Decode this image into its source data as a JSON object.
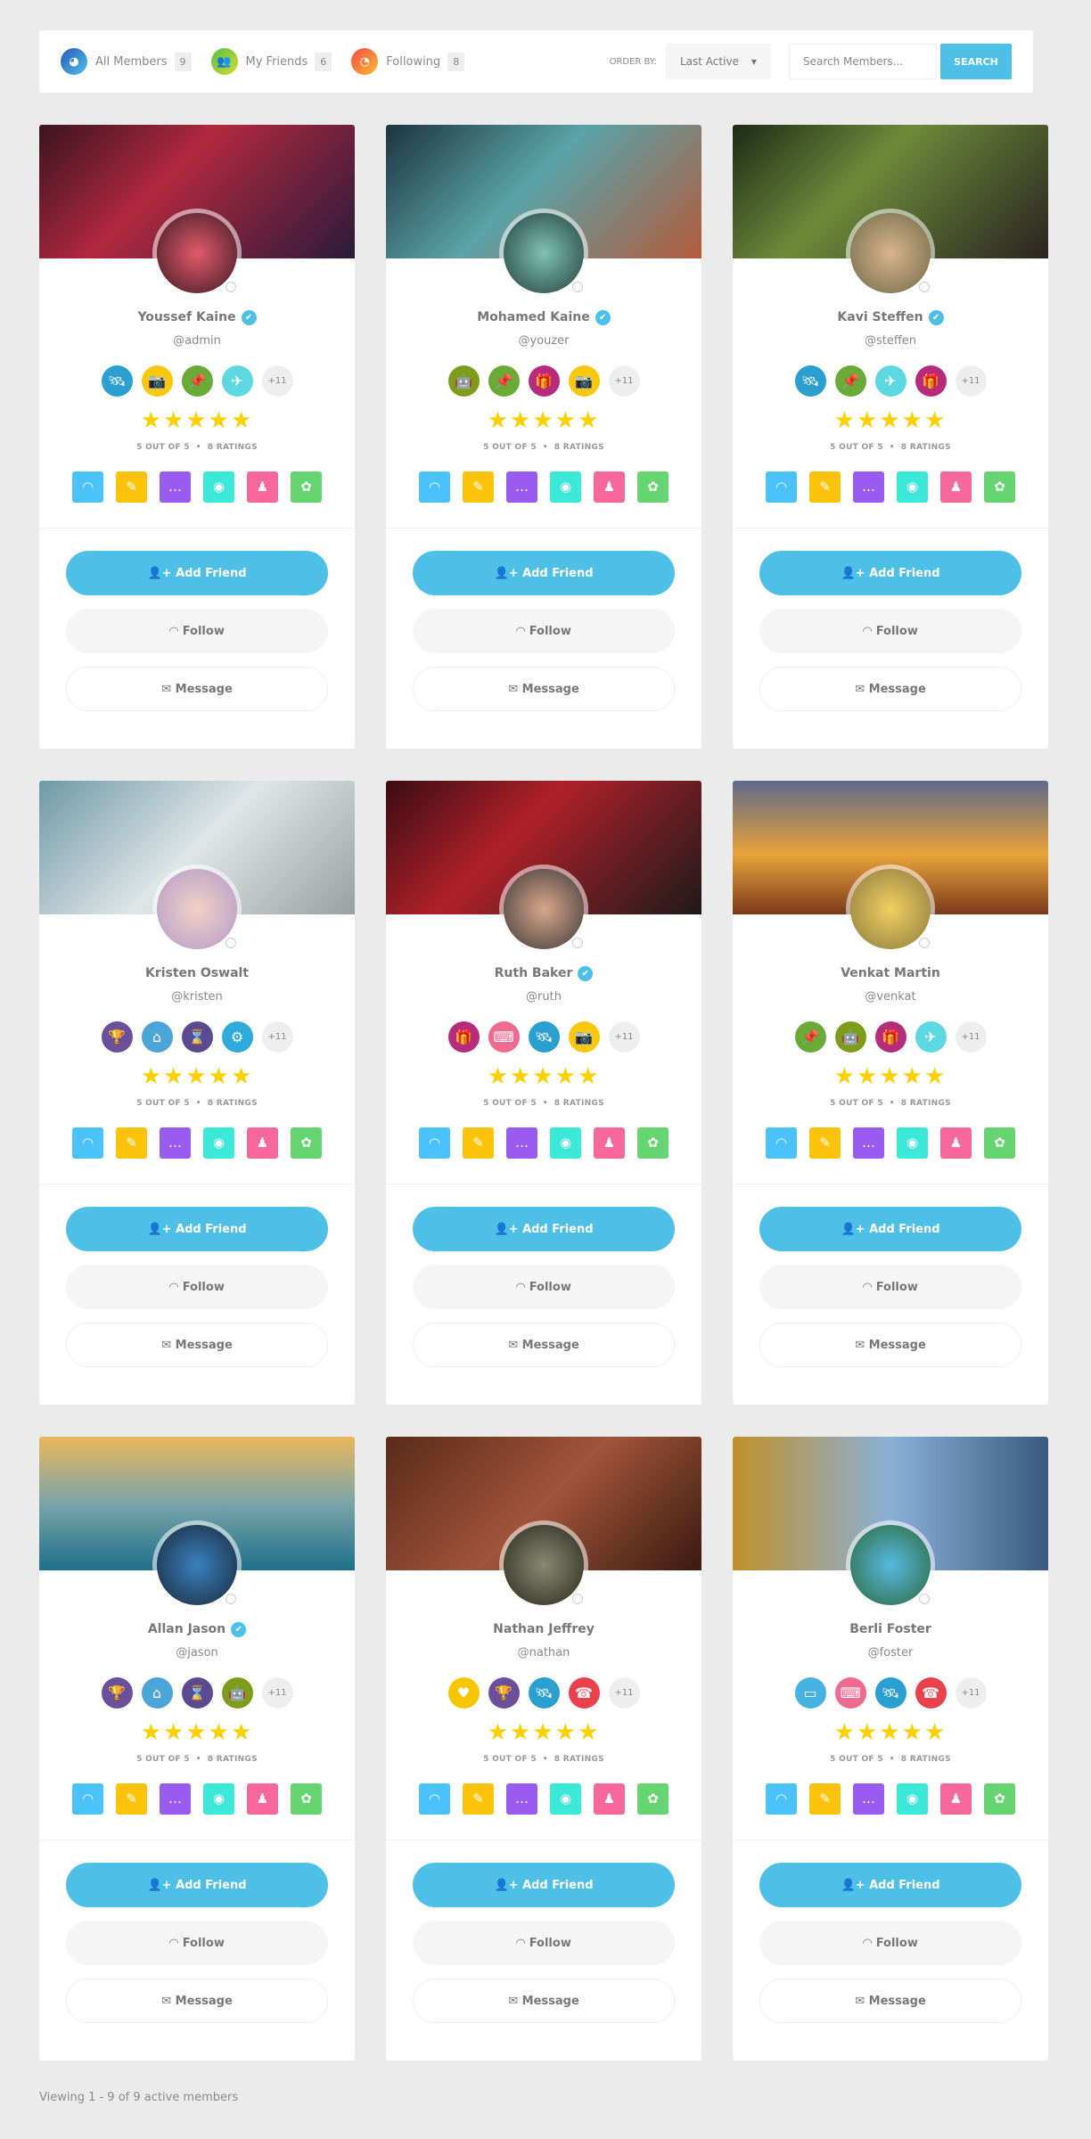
{
  "header": {
    "tabs": [
      {
        "label": "All Members",
        "count": "9",
        "icon": "globe-icon",
        "gradient": "linear-gradient(135deg,#2b5ab8,#4ec0e8)",
        "glyph": "◕"
      },
      {
        "label": "My Friends",
        "count": "6",
        "icon": "users-icon",
        "gradient": "linear-gradient(135deg,#56c043,#d6d936)",
        "glyph": "👥"
      },
      {
        "label": "Following",
        "count": "8",
        "icon": "rss-icon",
        "gradient": "linear-gradient(135deg,#f24a4a,#fdbb2d)",
        "glyph": "◔"
      }
    ],
    "order_label": "ORDER BY:",
    "order_value": "Last Active",
    "search_placeholder": "Search Members...",
    "search_button": "SEARCH"
  },
  "badge_colors": {
    "satellite": "#2a9fd0",
    "camera": "#f9c80e",
    "pin": "#6aab38",
    "plane": "#5ed8e0",
    "robot": "#7d9d1a",
    "gift": "#b62b7a",
    "trophy": "#6b4f9c",
    "house": "#4ba5d8",
    "hourglass": "#5b4a8f",
    "gear": "#2eaadc",
    "keyboard": "#ee6a8f",
    "heart": "#f6c700",
    "phone": "#e9424c",
    "monitor": "#46b2e0"
  },
  "actions": [
    {
      "icon": "rss-icon",
      "color": "#4cc2fa",
      "glyph": "◠"
    },
    {
      "icon": "pencil-icon",
      "color": "#fdc20a",
      "glyph": "✎"
    },
    {
      "icon": "chat-icon",
      "color": "#9a5cf0",
      "glyph": "…"
    },
    {
      "icon": "eye-monitor-icon",
      "color": "#3ce8d8",
      "glyph": "◉"
    },
    {
      "icon": "group-icon",
      "color": "#f6689a",
      "glyph": "♟"
    },
    {
      "icon": "award-icon",
      "color": "#66d470",
      "glyph": "✿"
    }
  ],
  "buttons": {
    "add_friend": "Add Friend",
    "follow": "Follow",
    "message": "Message"
  },
  "members": [
    {
      "name": "Youssef Kaine",
      "username": "@admin",
      "verified": true,
      "badges": [
        "satellite",
        "camera",
        "pin",
        "plane"
      ],
      "more": "+11",
      "stars": 5,
      "rating": "5 OUT OF 5",
      "ratings": "8 RATINGS",
      "cover": "linear-gradient(135deg,#3a1420,#b1283e 40%,#2a1b3b)",
      "avatar": "radial-gradient(circle,#e35a6a,#3c1b25)"
    },
    {
      "name": "Mohamed Kaine",
      "username": "@youzer",
      "verified": true,
      "badges": [
        "robot",
        "pin",
        "gift",
        "camera"
      ],
      "more": "+11",
      "stars": 5,
      "rating": "5 OUT OF 5",
      "ratings": "8 RATINGS",
      "cover": "linear-gradient(135deg,#1e3440,#5aa3a8 45%,#b45a3a)",
      "avatar": "radial-gradient(circle,#7ec2b0,#24403e)"
    },
    {
      "name": "Kavi Steffen",
      "username": "@steffen",
      "verified": true,
      "badges": [
        "satellite",
        "pin",
        "plane",
        "gift"
      ],
      "more": "+11",
      "stars": 5,
      "rating": "5 OUT OF 5",
      "ratings": "8 RATINGS",
      "cover": "linear-gradient(135deg,#1d2a16,#6d8a3a 40%,#2a2420)",
      "avatar": "radial-gradient(circle,#d9b48a,#6f6a4a)"
    },
    {
      "name": "Kristen Oswalt",
      "username": "@kristen",
      "verified": false,
      "badges": [
        "trophy",
        "house",
        "hourglass",
        "gear"
      ],
      "more": "+11",
      "stars": 5,
      "rating": "5 OUT OF 5",
      "ratings": "8 RATINGS",
      "cover": "linear-gradient(135deg,#6f98a8,#dfe6e6 50%,#9aa0a0)",
      "avatar": "radial-gradient(circle,#f2d1c6,#b39ac8)"
    },
    {
      "name": "Ruth Baker",
      "username": "@ruth",
      "verified": true,
      "badges": [
        "gift",
        "keyboard",
        "satellite",
        "camera"
      ],
      "more": "+11",
      "stars": 5,
      "rating": "5 OUT OF 5",
      "ratings": "8 RATINGS",
      "cover": "linear-gradient(135deg,#3a0d12,#b0202a 40%,#1e1a1a)",
      "avatar": "radial-gradient(circle,#d9a68a,#3b3b3b)"
    },
    {
      "name": "Venkat Martin",
      "username": "@venkat",
      "verified": false,
      "badges": [
        "pin",
        "robot",
        "gift",
        "plane"
      ],
      "more": "+11",
      "stars": 5,
      "rating": "5 OUT OF 5",
      "ratings": "8 RATINGS",
      "cover": "linear-gradient(180deg,#5c6a8a,#e9a33a 55%,#7a3a1a)",
      "avatar": "radial-gradient(circle,#f0d060,#8a7a40)"
    },
    {
      "name": "Allan Jason",
      "username": "@jason",
      "verified": true,
      "badges": [
        "trophy",
        "house",
        "hourglass",
        "robot"
      ],
      "more": "+11",
      "stars": 5,
      "rating": "5 OUT OF 5",
      "ratings": "8 RATINGS",
      "cover": "linear-gradient(180deg,#e8b85a,#7aa4a8 50%,#1f6f8a)",
      "avatar": "radial-gradient(circle,#3a80c0,#1a2a3a)"
    },
    {
      "name": "Nathan Jeffrey",
      "username": "@nathan",
      "verified": false,
      "badges": [
        "heart",
        "trophy",
        "satellite",
        "phone"
      ],
      "more": "+11",
      "stars": 5,
      "rating": "5 OUT OF 5",
      "ratings": "8 RATINGS",
      "cover": "linear-gradient(135deg,#5a2a1a,#a0553a 50%,#3a1a10)",
      "avatar": "radial-gradient(circle,#8a8a70,#2a2a20)"
    },
    {
      "name": "Berli Foster",
      "username": "@foster",
      "verified": false,
      "badges": [
        "monitor",
        "keyboard",
        "satellite",
        "phone"
      ],
      "more": "+11",
      "stars": 5,
      "rating": "5 OUT OF 5",
      "ratings": "8 RATINGS",
      "cover": "linear-gradient(90deg,#c0902a,#8ab0d8 50%,#3a5a80)",
      "avatar": "radial-gradient(circle,#58b8e0,#2a6a3a)"
    }
  ],
  "footer": "Viewing 1 - 9 of 9 active members"
}
